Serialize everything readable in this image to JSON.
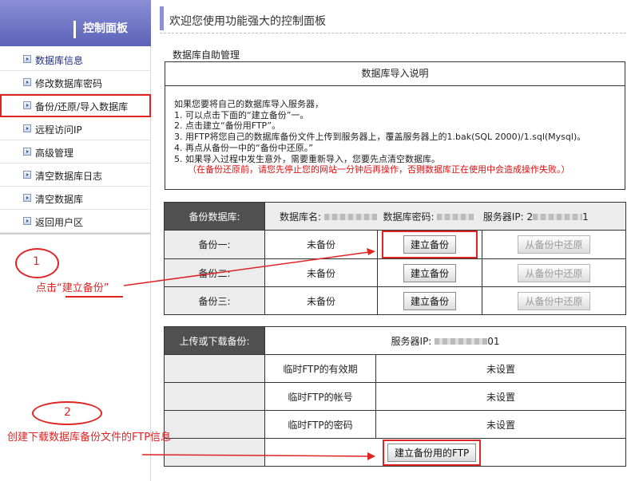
{
  "sidebar": {
    "title": "控制面板",
    "items": [
      {
        "label": "数据库信息"
      },
      {
        "label": "修改数据库密码"
      },
      {
        "label": "备份/还原/导入数据库"
      },
      {
        "label": "远程访问IP"
      },
      {
        "label": "高级管理"
      },
      {
        "label": "清空数据库日志"
      },
      {
        "label": "清空数据库"
      },
      {
        "label": "返回用户区"
      }
    ]
  },
  "header": {
    "title": "欢迎您使用功能强大的控制面板"
  },
  "section": {
    "title": "数据库自助管理"
  },
  "info": {
    "heading": "数据库导入说明",
    "lines": [
      "如果您要将自己的数据库导入服务器，",
      "1. 可以点击下面的“建立备份”一。",
      "2. 点击建立“备份用FTP”。",
      "3. 用FTP将您自己的数据库备份文件上传到服务器上，覆盖服务器上的1.bak(SQL 2000)/1.sql(Mysql)。",
      "4. 再点从备份一中的“备份中还原。”",
      "5. 如果导入过程中发生意外，需要重新导入，您要先点清空数据库。"
    ],
    "warning": "（在备份还原前，请您先停止您的网站一分钟后再操作，否则数据库正在使用中会造成操作失败。）"
  },
  "backup": {
    "header_label": "备份数据库:",
    "db_name_label": "数据库名:",
    "db_pass_label": "数据库密码:",
    "server_ip_label": "服务器IP:",
    "server_ip_prefix": "2",
    "server_ip_suffix": "1",
    "rows": [
      {
        "name": "备份一:",
        "status": "未备份",
        "create": "建立备份",
        "restore": "从备份中还原"
      },
      {
        "name": "备份二:",
        "status": "未备份",
        "create": "建立备份",
        "restore": "从备份中还原"
      },
      {
        "name": "备份三:",
        "status": "未备份",
        "create": "建立备份",
        "restore": "从备份中还原"
      }
    ]
  },
  "ftp": {
    "header_label": "上传或下载备份:",
    "server_ip_label": "服务器IP:",
    "server_ip_suffix": "01",
    "rows": [
      {
        "label": "临时FTP的有效期",
        "value": "未设置"
      },
      {
        "label": "临时FTP的帐号",
        "value": "未设置"
      },
      {
        "label": "临时FTP的密码",
        "value": "未设置"
      }
    ],
    "create_button": "建立备份用的FTP"
  },
  "annotations": {
    "one": {
      "number": "1",
      "text": "点击“建立备份”"
    },
    "two": {
      "number": "2",
      "text": "创建下载数据库备份文件的FTP信息"
    }
  },
  "colors": {
    "annotation": "#e02323",
    "header_dark": "#505050",
    "sidebar_header": "#6e74c6"
  }
}
